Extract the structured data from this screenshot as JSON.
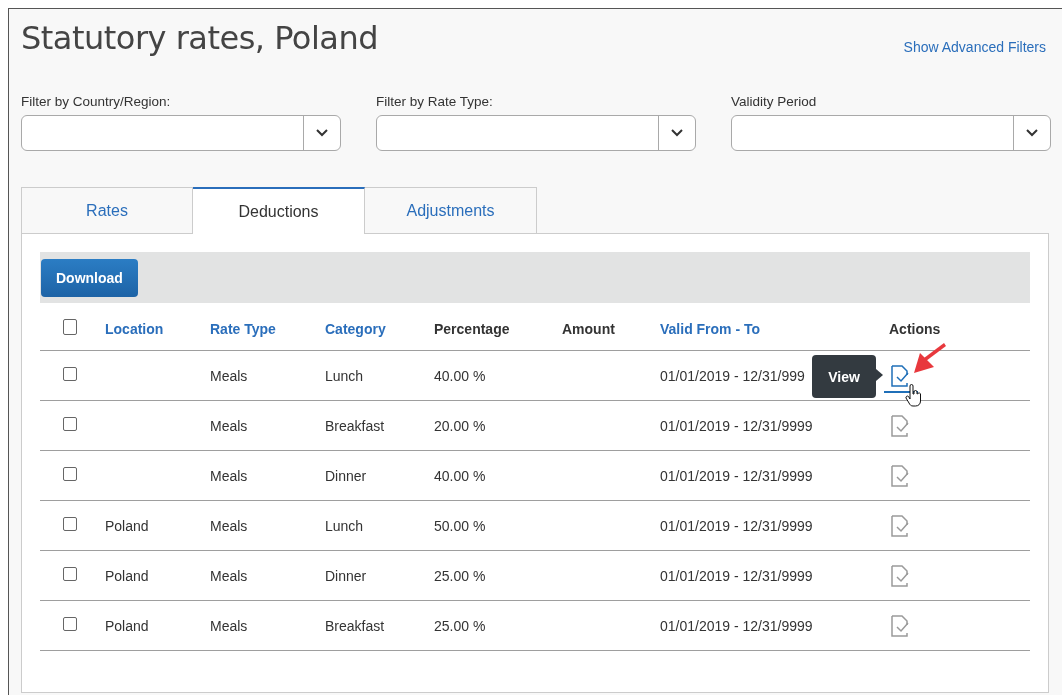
{
  "title": "Statutory rates, Poland",
  "advanced_filters_link": "Show Advanced Filters",
  "filters": [
    {
      "label": "Filter by Country/Region:"
    },
    {
      "label": "Filter by Rate Type:"
    },
    {
      "label": "Validity Period"
    }
  ],
  "tabs": [
    {
      "label": "Rates",
      "selected": false
    },
    {
      "label": "Deductions",
      "selected": true
    },
    {
      "label": "Adjustments",
      "selected": false
    }
  ],
  "toolbar": {
    "button": "Download"
  },
  "table": {
    "select_all_checked": false,
    "columns": [
      {
        "label": "Location",
        "sortable": true
      },
      {
        "label": "Rate Type",
        "sortable": true
      },
      {
        "label": "Category",
        "sortable": true
      },
      {
        "label": "Percentage",
        "sortable": false
      },
      {
        "label": "Amount",
        "sortable": false
      },
      {
        "label": "Valid From - To",
        "sortable": true
      },
      {
        "label": "Actions",
        "sortable": false
      }
    ],
    "rows": [
      {
        "checked": false,
        "location": "",
        "rate_type": "Meals",
        "category": "Lunch",
        "percentage": "40.00 %",
        "amount": "",
        "valid": "01/01/2019 - 12/31/999",
        "action_hovered": true,
        "tooltip": "View"
      },
      {
        "checked": false,
        "location": "",
        "rate_type": "Meals",
        "category": "Breakfast",
        "percentage": "20.00 %",
        "amount": "",
        "valid": "01/01/2019 - 12/31/9999",
        "action_hovered": false
      },
      {
        "checked": false,
        "location": "",
        "rate_type": "Meals",
        "category": "Dinner",
        "percentage": "40.00 %",
        "amount": "",
        "valid": "01/01/2019 - 12/31/9999",
        "action_hovered": false
      },
      {
        "checked": false,
        "location": "Poland",
        "rate_type": "Meals",
        "category": "Lunch",
        "percentage": "50.00 %",
        "amount": "",
        "valid": "01/01/2019 - 12/31/9999",
        "action_hovered": false
      },
      {
        "checked": false,
        "location": "Poland",
        "rate_type": "Meals",
        "category": "Dinner",
        "percentage": "25.00 %",
        "amount": "",
        "valid": "01/01/2019 - 12/31/9999",
        "action_hovered": false
      },
      {
        "checked": false,
        "location": "Poland",
        "rate_type": "Meals",
        "category": "Breakfast",
        "percentage": "25.00 %",
        "amount": "",
        "valid": "01/01/2019 - 12/31/9999",
        "action_hovered": false
      }
    ]
  }
}
